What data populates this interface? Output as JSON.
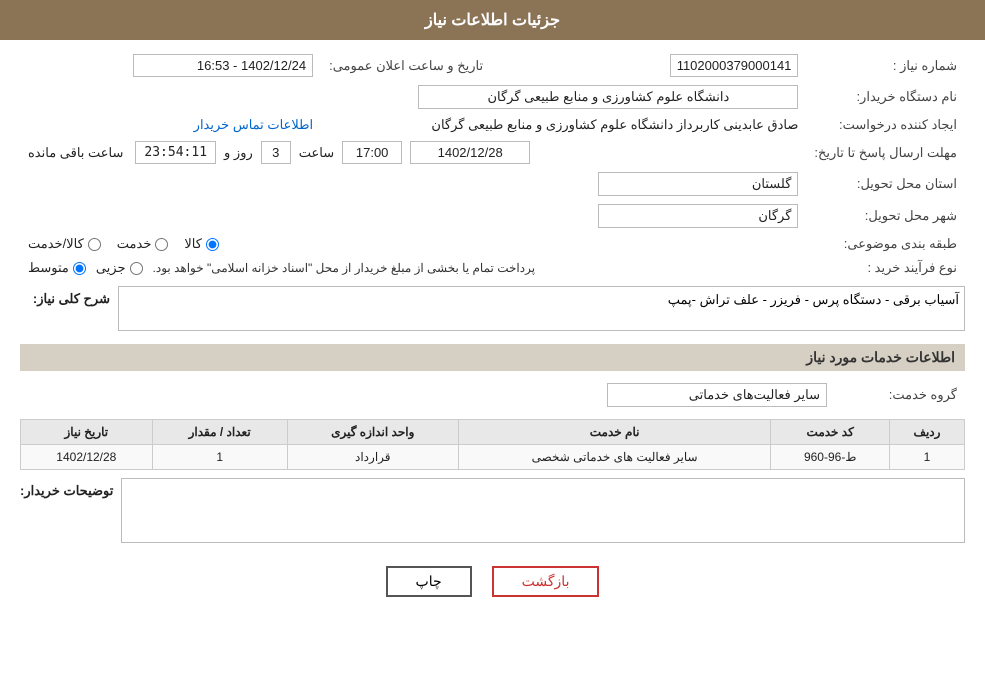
{
  "header": {
    "title": "جزئیات اطلاعات نیاز"
  },
  "fields": {
    "need_number_label": "شماره نیاز :",
    "need_number_value": "1102000379000141",
    "announcement_label": "تاریخ و ساعت اعلان عمومی:",
    "announcement_value": "1402/12/24 - 16:53",
    "buyer_org_label": "نام دستگاه خریدار:",
    "buyer_org_value": "دانشگاه علوم کشاورزی و منابع طبیعی گرگان",
    "creator_label": "ایجاد کننده درخواست:",
    "creator_value": "صادق عابدینی کاربرداز دانشگاه علوم کشاورزی و منابع طبیعی گرگان",
    "contact_link": "اطلاعات تماس خریدار",
    "deadline_label": "مهلت ارسال پاسخ تا تاریخ:",
    "deadline_date": "1402/12/28",
    "deadline_time_label": "ساعت",
    "deadline_time": "17:00",
    "deadline_days_label": "روز و",
    "deadline_days": "3",
    "deadline_remaining_label": "ساعت باقی مانده",
    "deadline_remaining": "23:54:11",
    "province_label": "استان محل تحویل:",
    "province_value": "گلستان",
    "city_label": "شهر محل تحویل:",
    "city_value": "گرگان",
    "category_label": "طبقه بندی موضوعی:",
    "category_options": [
      {
        "value": "goods",
        "label": "کالا"
      },
      {
        "value": "service",
        "label": "خدمت"
      },
      {
        "value": "goods_service",
        "label": "کالا/خدمت"
      }
    ],
    "category_selected": "goods",
    "purchase_type_label": "نوع فرآیند خرید :",
    "purchase_options": [
      {
        "value": "partial",
        "label": "جزیی"
      },
      {
        "value": "medium",
        "label": "متوسط"
      }
    ],
    "purchase_selected": "medium",
    "purchase_note": "پرداخت تمام یا بخشی از مبلغ خریدار از محل \"اسناد خزانه اسلامی\" خواهد بود.",
    "need_desc_label": "شرح کلی نیاز:",
    "need_desc_value": "آسیاب برقی - دستگاه پرس - فریزر - علف تراش -پمپ"
  },
  "services_section": {
    "title": "اطلاعات خدمات مورد نیاز",
    "service_group_label": "گروه خدمت:",
    "service_group_value": "سایر فعالیت‌های خدماتی",
    "table": {
      "columns": [
        "ردیف",
        "کد خدمت",
        "نام خدمت",
        "واحد اندازه گیری",
        "تعداد / مقدار",
        "تاریخ نیاز"
      ],
      "rows": [
        {
          "row_num": "1",
          "service_code": "ط-96-960",
          "service_name": "سایر فعالیت های خدماتی شخصی",
          "unit": "قرارداد",
          "quantity": "1",
          "need_date": "1402/12/28"
        }
      ]
    }
  },
  "buyer_desc": {
    "label": "توضیحات خریدار:",
    "value": ""
  },
  "buttons": {
    "print": "چاپ",
    "back": "بازگشت"
  }
}
